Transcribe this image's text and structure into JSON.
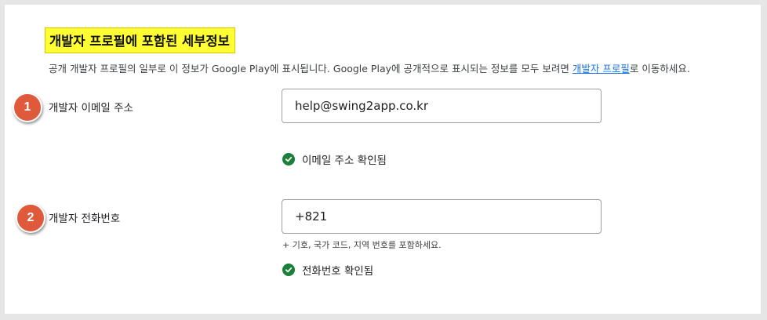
{
  "section": {
    "title": "개발자 프로필에 포함된 세부정보",
    "description_prefix": "공개 개발자 프로필의 일부로 이 정보가 Google Play에 표시됩니다. Google Play에 공개적으로 표시되는 정보를 모두 보려면 ",
    "description_link": "개발자 프로필",
    "description_suffix": "로 이동하세요."
  },
  "email": {
    "step": "1",
    "label": "개발자 이메일 주소",
    "value": "help@swing2app.co.kr",
    "verified_text": "이메일 주소 확인됨"
  },
  "phone": {
    "step": "2",
    "label": "개발자 전화번호",
    "value": "+821",
    "hint": "+ 기호, 국가 코드, 지역 번호를 포함하세요.",
    "verified_text": "전화번호 확인됨"
  },
  "colors": {
    "highlight": "#ffff33",
    "badge": "#df5a3a",
    "verified_green": "#188038",
    "link_blue": "#1a73e8"
  }
}
